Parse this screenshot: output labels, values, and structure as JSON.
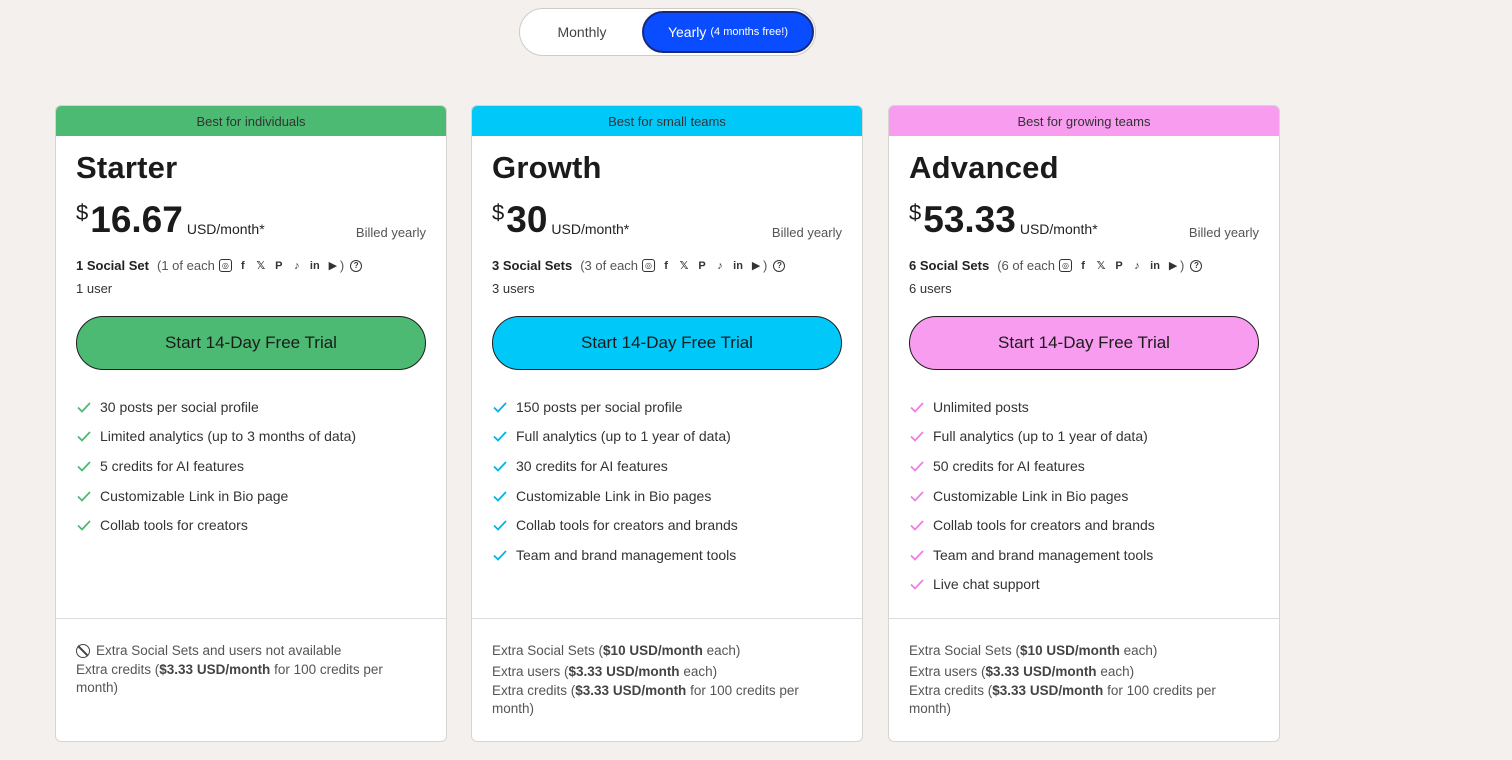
{
  "billing_toggle": {
    "monthly_label": "Monthly",
    "yearly_label": "Yearly",
    "yearly_note": "(4 months free!)"
  },
  "plans": [
    {
      "banner": "Best for individuals",
      "accent": "#4cba72",
      "name": "Starter",
      "currency": "$",
      "amount": "16.67",
      "per": "USD/month*",
      "billed": "Billed yearly",
      "sets_label": "1 Social Set",
      "sets_each": "(1 of each",
      "users": "1 user",
      "cta": "Start 14-Day Free Trial",
      "features": [
        "30 posts per social profile",
        "Limited analytics (up to 3 months of data)",
        "5 credits for AI features",
        "Customizable Link in Bio page",
        "Collab tools for creators"
      ],
      "footer": {
        "unavailable": "Extra Social Sets and users not available",
        "credits_prefix": "Extra credits (",
        "credits_bold": "$3.33 USD/month",
        "credits_suffix": " for 100 credits per month)"
      }
    },
    {
      "banner": "Best for small teams",
      "accent": "#00c8f8",
      "name": "Growth",
      "currency": "$",
      "amount": "30",
      "per": "USD/month*",
      "billed": "Billed yearly",
      "sets_label": "3 Social Sets",
      "sets_each": "(3 of each",
      "users": "3 users",
      "cta": "Start 14-Day Free Trial",
      "features": [
        "150 posts per social profile",
        "Full analytics (up to 1 year of data)",
        "30 credits for AI features",
        "Customizable Link in Bio pages",
        "Collab tools for creators and brands",
        "Team and brand management tools"
      ],
      "footer": {
        "sets_prefix": "Extra Social Sets (",
        "sets_bold": "$10 USD/month",
        "sets_suffix": " each)",
        "users_prefix": "Extra users (",
        "users_bold": "$3.33 USD/month",
        "users_suffix": " each)",
        "credits_prefix": "Extra credits (",
        "credits_bold": "$3.33 USD/month",
        "credits_suffix": " for 100 credits per month)"
      }
    },
    {
      "banner": "Best for growing teams",
      "accent": "#f79cef",
      "name": "Advanced",
      "currency": "$",
      "amount": "53.33",
      "per": "USD/month*",
      "billed": "Billed yearly",
      "sets_label": "6 Social Sets",
      "sets_each": "(6 of each",
      "users": "6 users",
      "cta": "Start 14-Day Free Trial",
      "features": [
        "Unlimited posts",
        "Full analytics (up to 1 year of data)",
        "50 credits for AI features",
        "Customizable Link in Bio pages",
        "Collab tools for creators and brands",
        "Team and brand management tools",
        "Live chat support"
      ],
      "footer": {
        "sets_prefix": "Extra Social Sets (",
        "sets_bold": "$10 USD/month",
        "sets_suffix": " each)",
        "users_prefix": "Extra users (",
        "users_bold": "$3.33 USD/month",
        "users_suffix": " each)",
        "credits_prefix": "Extra credits (",
        "credits_bold": "$3.33 USD/month",
        "credits_suffix": " for 100 credits per month)"
      }
    }
  ],
  "icons": [
    "instagram-icon",
    "facebook-icon",
    "x-icon",
    "pinterest-icon",
    "tiktok-icon",
    "linkedin-icon",
    "youtube-icon",
    "help-icon",
    "check-icon",
    "not-available-icon"
  ],
  "icon_glyphs": {
    "facebook": "f",
    "x": "𝕏",
    "pinterest": "P",
    "tiktok": "♪",
    "linkedin": "in",
    "youtube": "▶",
    "help": "?",
    "instagram": "◎",
    "close_paren": ")"
  }
}
